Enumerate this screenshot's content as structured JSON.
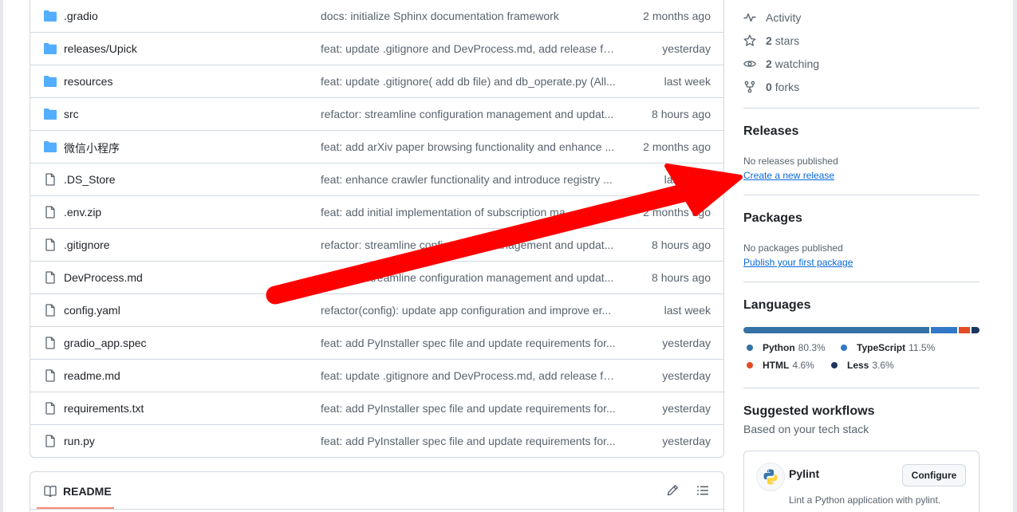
{
  "files": [
    {
      "name": ".gradio",
      "type": "folder",
      "message": "docs: initialize Sphinx documentation framework",
      "time": "2 months ago"
    },
    {
      "name": "releases/Upick",
      "type": "folder",
      "message": "feat: update .gitignore and DevProcess.md, add release fil...",
      "time": "yesterday"
    },
    {
      "name": "resources",
      "type": "folder",
      "message": "feat: update .gitignore( add db file) and db_operate.py (All...",
      "time": "last week"
    },
    {
      "name": "src",
      "type": "folder",
      "message": "refactor: streamline configuration management and updat...",
      "time": "8 hours ago"
    },
    {
      "name": "微信小程序",
      "type": "folder",
      "message": "feat: add arXiv paper browsing functionality and enhance ...",
      "time": "2 months ago"
    },
    {
      "name": ".DS_Store",
      "type": "file",
      "message": "feat: enhance crawler functionality and introduce registry ...",
      "time": "last week"
    },
    {
      "name": ".env.zip",
      "type": "file",
      "message": "feat: add initial implementation of subscription ma...",
      "time": "2 months ago"
    },
    {
      "name": ".gitignore",
      "type": "file",
      "message": "refactor: streamline configuration management and updat...",
      "time": "8 hours ago"
    },
    {
      "name": "DevProcess.md",
      "type": "file",
      "message": "refactor: streamline configuration management and updat...",
      "time": "8 hours ago"
    },
    {
      "name": "config.yaml",
      "type": "file",
      "message": "refactor(config): update app configuration and improve er...",
      "time": "last week"
    },
    {
      "name": "gradio_app.spec",
      "type": "file",
      "message": "feat: add PyInstaller spec file and update requirements for...",
      "time": "yesterday"
    },
    {
      "name": "readme.md",
      "type": "file",
      "message": "feat: update .gitignore and DevProcess.md, add release fil...",
      "time": "yesterday"
    },
    {
      "name": "requirements.txt",
      "type": "file",
      "message": "feat: add PyInstaller spec file and update requirements for...",
      "time": "yesterday"
    },
    {
      "name": "run.py",
      "type": "file",
      "message": "feat: add PyInstaller spec file and update requirements for...",
      "time": "yesterday"
    }
  ],
  "readme": {
    "title": "README"
  },
  "sidebar": {
    "activity": "Activity",
    "stars": {
      "count": "2",
      "label": "stars"
    },
    "watching": {
      "count": "2",
      "label": "watching"
    },
    "forks": {
      "count": "0",
      "label": "forks"
    },
    "releases": {
      "title": "Releases",
      "note": "No releases published",
      "link": "Create a new release"
    },
    "packages": {
      "title": "Packages",
      "note": "No packages published",
      "link": "Publish your first package"
    },
    "languages": {
      "title": "Languages",
      "items": [
        {
          "name": "Python",
          "percent": "80.3%",
          "value": 80.3,
          "color": "#3572A5"
        },
        {
          "name": "TypeScript",
          "percent": "11.5%",
          "value": 11.5,
          "color": "#3178c6"
        },
        {
          "name": "HTML",
          "percent": "4.6%",
          "value": 4.6,
          "color": "#e34c26"
        },
        {
          "name": "Less",
          "percent": "3.6%",
          "value": 3.6,
          "color": "#1d365d"
        }
      ]
    },
    "workflows": {
      "title": "Suggested workflows",
      "subtitle": "Based on your tech stack",
      "card": {
        "name": "Pylint",
        "button": "Configure",
        "description": "Lint a Python application with pylint."
      }
    }
  },
  "colors": {
    "folder": "#54aeff",
    "arrow": "#ff0000",
    "link": "#0969da"
  }
}
